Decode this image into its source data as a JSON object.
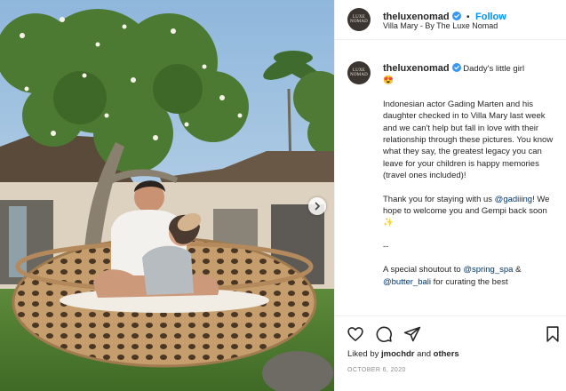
{
  "account": {
    "username": "theluxenomad",
    "avatar_text": "LUXE NOMAD",
    "follow_separator": "•",
    "follow_label": "Follow"
  },
  "location": "Villa Mary - By The Luxe Nomad",
  "caption": {
    "username": "theluxenomad",
    "first_line": "Daddy's little girl",
    "emoji_heart_eyes": "😍",
    "para1": "Indonesian actor Gading Marten and his daughter checked in to Villa Mary last week and we can't help but fall in love with their relationship through these pictures. You know what they say, the greatest legacy you can leave for your children is happy memories (travel ones included)!",
    "para2_a": "Thank you for staying with us ",
    "para2_mention": "@gadiiing",
    "para2_b": "! We hope to welcome you and Gempi back soon ",
    "emoji_sparkle": "✨",
    "divider": "--",
    "para4_a": "A special shoutout to ",
    "para4_mention1": "@spring_spa",
    "para4_b": " & ",
    "para4_mention2": "@butter_bali",
    "para4_c": " for curating the best"
  },
  "likes": {
    "prefix": "Liked by ",
    "user": "jmochdr",
    "middle": " and ",
    "others": "others"
  },
  "date": "OCTOBER 6, 2020",
  "icons": [
    "heart-icon",
    "comment-icon",
    "share-icon",
    "bookmark-icon",
    "chevron-right-icon",
    "verified-icon"
  ],
  "colors": {
    "accent": "#0095f6",
    "verified": "#3897f0",
    "text": "#262626",
    "muted": "#8e8e8e"
  }
}
